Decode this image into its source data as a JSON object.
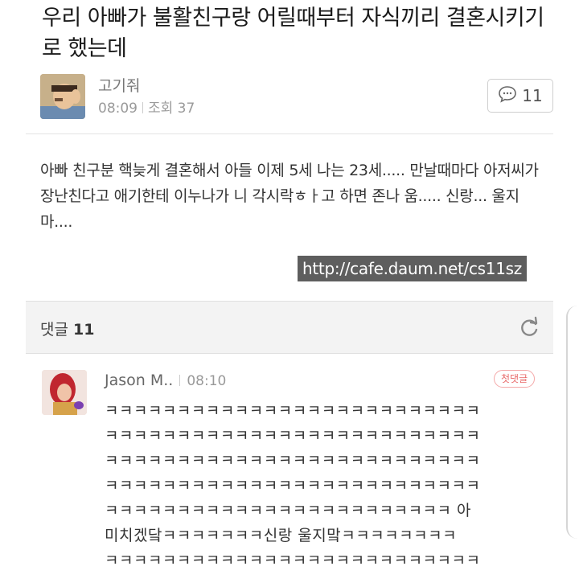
{
  "post": {
    "title": "우리 아빠가 불활친구랑 어릴때부터 자식끼리 결혼시키기로 했는데",
    "author": "고기줘",
    "time": "08:09",
    "views": "조회 37",
    "comment_count": "11",
    "body": "아빠 친구분 핵늦게 결혼해서 아들 이제 5세 나는 23세..... 만날때마다 아저씨가 장난친다고 애기한테 이누나가 니 각시락ㅎㅏ고 하면 존나 움..... 신랑... 울지마....",
    "link": "http://cafe.daum.net/cs11sz"
  },
  "comments_header": {
    "label": "댓글",
    "count": "11"
  },
  "comment": {
    "author": "Jason M..",
    "time": "08:10",
    "badge": "첫댓글",
    "lines": [
      "ㅋㅋㅋㅋㅋㅋㅋㅋㅋㅋㅋㅋㅋㅋㅋㅋㅋㅋㅋㅋㅋㅋㅋㅋㅋㅋ",
      "ㅋㅋㅋㅋㅋㅋㅋㅋㅋㅋㅋㅋㅋㅋㅋㅋㅋㅋㅋㅋㅋㅋㅋㅋㅋㅋ",
      "ㅋㅋㅋㅋㅋㅋㅋㅋㅋㅋㅋㅋㅋㅋㅋㅋㅋㅋㅋㅋㅋㅋㅋㅋㅋㅋ",
      "ㅋㅋㅋㅋㅋㅋㅋㅋㅋㅋㅋㅋㅋㅋㅋㅋㅋㅋㅋㅋㅋㅋㅋㅋㅋㅋ",
      "ㅋㅋㅋㅋㅋㅋㅋㅋㅋㅋㅋㅋㅋㅋㅋㅋㅋㅋㅋㅋㅋㅋㅋㅋ 아",
      "미치겠닼ㅋㅋㅋㅋㅋㅋㅋ신랑 울지맠ㅋㅋㅋㅋㅋㅋㅋㅋ",
      "ㅋㅋㅋㅋㅋㅋㅋㅋㅋㅋㅋㅋㅋㅋㅋㅋㅋㅋㅋㅋㅋㅋㅋㅋㅋㅋ"
    ]
  },
  "icons": {
    "comment": "speech-bubble-icon",
    "refresh": "refresh-icon"
  },
  "colors": {
    "badge": "#e86a6a",
    "link_bg": "#5e5e5e",
    "band_bg": "#f3f3f3"
  }
}
